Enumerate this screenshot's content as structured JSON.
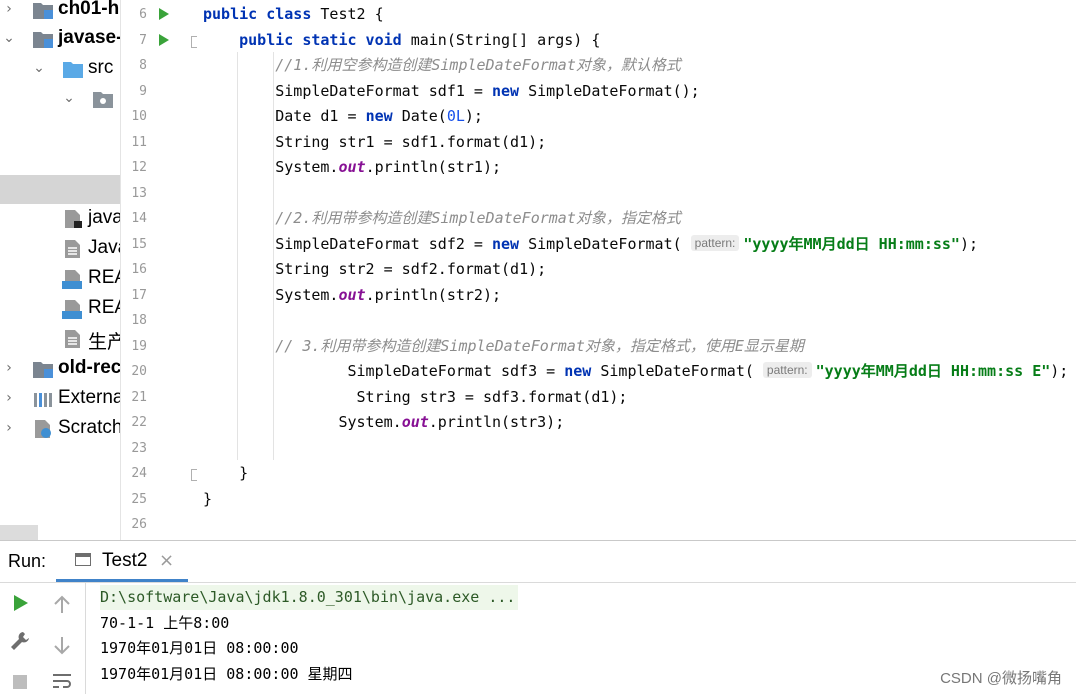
{
  "project_tree": {
    "items": [
      {
        "label": "ch01-h",
        "bold": true
      },
      {
        "label": "javase-",
        "bold": true
      },
      {
        "label": "src"
      },
      {
        "label": ""
      },
      {
        "label": "java"
      },
      {
        "label": "Java"
      },
      {
        "label": "REA"
      },
      {
        "label": "REA"
      },
      {
        "label": "生产"
      },
      {
        "label": "old-rec",
        "bold": true
      },
      {
        "label": "Externa"
      },
      {
        "label": "Scratch"
      }
    ],
    "md_badge": "MD"
  },
  "editor": {
    "line_numbers": [
      "6",
      "7",
      "8",
      "9",
      "10",
      "11",
      "12",
      "13",
      "14",
      "15",
      "16",
      "17",
      "18",
      "19",
      "20",
      "21",
      "22",
      "23",
      "24",
      "25",
      "26"
    ],
    "hints": {
      "pattern": "pattern:"
    },
    "lines": [
      {
        "segments": [
          {
            "t": "kw",
            "v": "public class "
          },
          {
            "t": "",
            "v": "Test2 {"
          }
        ]
      },
      {
        "segments": [
          {
            "t": "",
            "v": "    "
          },
          {
            "t": "kw",
            "v": "public static void "
          },
          {
            "t": "",
            "v": "main(String[] args) {"
          }
        ]
      },
      {
        "segments": [
          {
            "t": "",
            "v": "        "
          },
          {
            "t": "cmt",
            "v": "//1.利用空参构造创建SimpleDateFormat对象，默认格式"
          }
        ]
      },
      {
        "segments": [
          {
            "t": "",
            "v": "        SimpleDateFormat sdf1 = "
          },
          {
            "t": "kw",
            "v": "new "
          },
          {
            "t": "",
            "v": "SimpleDateFormat();"
          }
        ]
      },
      {
        "segments": [
          {
            "t": "",
            "v": "        Date d1 = "
          },
          {
            "t": "kw",
            "v": "new "
          },
          {
            "t": "",
            "v": "Date("
          },
          {
            "t": "num",
            "v": "0L"
          },
          {
            "t": "",
            "v": ");"
          }
        ]
      },
      {
        "segments": [
          {
            "t": "",
            "v": "        String str1 = sdf1.format(d1);"
          }
        ]
      },
      {
        "segments": [
          {
            "t": "",
            "v": "        System."
          },
          {
            "t": "fld",
            "v": "out"
          },
          {
            "t": "",
            "v": ".println(str1);"
          }
        ]
      },
      {
        "segments": []
      },
      {
        "segments": [
          {
            "t": "",
            "v": "        "
          },
          {
            "t": "cmt",
            "v": "//2.利用带参构造创建SimpleDateFormat对象，指定格式"
          }
        ]
      },
      {
        "segments": [
          {
            "t": "",
            "v": "        SimpleDateFormat sdf2 = "
          },
          {
            "t": "kw",
            "v": "new "
          },
          {
            "t": "",
            "v": "SimpleDateFormat( "
          },
          {
            "t": "hint",
            "v": "pattern:"
          },
          {
            "t": "str",
            "v": "\"yyyy年MM月dd日 HH:mm:ss\""
          },
          {
            "t": "",
            "v": ");"
          }
        ]
      },
      {
        "segments": [
          {
            "t": "",
            "v": "        String str2 = sdf2.format(d1);"
          }
        ]
      },
      {
        "segments": [
          {
            "t": "",
            "v": "        System."
          },
          {
            "t": "fld",
            "v": "out"
          },
          {
            "t": "",
            "v": ".println(str2);"
          }
        ]
      },
      {
        "segments": []
      },
      {
        "segments": [
          {
            "t": "",
            "v": "        "
          },
          {
            "t": "cmt",
            "v": "// 3.利用带参构造创建SimpleDateFormat对象，指定格式，使用E显示星期"
          }
        ]
      },
      {
        "segments": [
          {
            "t": "",
            "v": "                SimpleDateFormat sdf3 = "
          },
          {
            "t": "kw",
            "v": "new "
          },
          {
            "t": "",
            "v": "SimpleDateFormat( "
          },
          {
            "t": "hint",
            "v": "pattern:"
          },
          {
            "t": "str",
            "v": "\"yyyy年MM月dd日 HH:mm:ss E\""
          },
          {
            "t": "",
            "v": ");"
          }
        ]
      },
      {
        "segments": [
          {
            "t": "",
            "v": "                 String str3 = sdf3.format(d1);"
          }
        ]
      },
      {
        "segments": [
          {
            "t": "",
            "v": "               System."
          },
          {
            "t": "fld",
            "v": "out"
          },
          {
            "t": "",
            "v": ".println(str3);"
          }
        ]
      },
      {
        "segments": []
      },
      {
        "segments": [
          {
            "t": "",
            "v": "    }"
          }
        ]
      },
      {
        "segments": [
          {
            "t": "",
            "v": "}"
          }
        ]
      },
      {
        "segments": []
      }
    ]
  },
  "run_panel": {
    "label": "Run:",
    "tab_label": "Test2",
    "tab_close": "×",
    "console_lines": [
      "D:\\software\\Java\\jdk1.8.0_301\\bin\\java.exe ...",
      "70-1-1 上午8:00",
      "1970年01月01日 08:00:00",
      "1970年01月01日 08:00:00 星期四"
    ]
  },
  "watermark": "CSDN @微扬嘴角",
  "colors": {
    "keyword": "#0033b3",
    "comment": "#8c8c8c",
    "string": "#067d17",
    "number": "#1750eb",
    "field": "#871094",
    "run_green": "#3aa33a",
    "tab_underline": "#4083c9"
  },
  "icons": {
    "tree_folder": "folder-icon",
    "tree_source": "source-folder-icon",
    "tree_file": "java-file-icon",
    "tree_md": "markdown-file-icon",
    "tree_library": "external-libraries-icon",
    "tree_scratch": "scratch-icon",
    "gutter_run": "run-gutter-icon",
    "toolbar_run": "play-icon",
    "toolbar_up": "arrow-up-icon",
    "toolbar_down": "arrow-down-icon",
    "toolbar_settings": "wrench-icon",
    "toolbar_wrap": "soft-wrap-icon",
    "toolbar_stop": "stop-icon"
  }
}
